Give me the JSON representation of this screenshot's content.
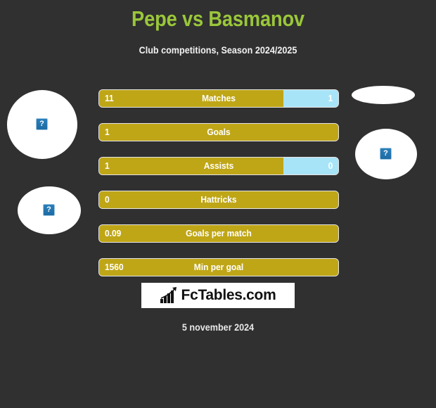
{
  "header": {
    "title": "Pepe vs Basmanov",
    "subtitle": "Club competitions, Season 2024/2025",
    "title_color": "#9ac73a"
  },
  "photos": {
    "home_top": {
      "alt_icon": "broken-image-icon",
      "glyph": "?"
    },
    "home_bottom": {
      "alt_icon": "broken-image-icon",
      "glyph": "?"
    },
    "away_top": {
      "alt_icon": "",
      "glyph": ""
    },
    "away_bottom": {
      "alt_icon": "broken-image-icon",
      "glyph": "?"
    }
  },
  "colors": {
    "home_bar": "#bfa617",
    "away_bar": "#a8e4f7",
    "background": "#303030",
    "bar_border": "#e6e6e6"
  },
  "chart_data": {
    "type": "bar",
    "title": "Pepe vs Basmanov",
    "subtitle": "Club competitions, Season 2024/2025",
    "orientation": "horizontal-diverging",
    "series": [
      {
        "name": "Pepe",
        "color": "#bfa617",
        "values": [
          11,
          1,
          1,
          0,
          0.09,
          1560
        ]
      },
      {
        "name": "Basmanov",
        "color": "#a8e4f7",
        "values": [
          1,
          0,
          0,
          0,
          0,
          0
        ]
      }
    ],
    "categories": [
      "Matches",
      "Goals",
      "Assists",
      "Hattricks",
      "Goals per match",
      "Min per goal"
    ],
    "rows": [
      {
        "label": "Matches",
        "home_value": "11",
        "away_value": "1",
        "home_pct": 77,
        "away_pct": 23,
        "show_away": true
      },
      {
        "label": "Goals",
        "home_value": "1",
        "away_value": "",
        "home_pct": 100,
        "away_pct": 0,
        "show_away": false
      },
      {
        "label": "Assists",
        "home_value": "1",
        "away_value": "0",
        "home_pct": 77,
        "away_pct": 23,
        "show_away": true
      },
      {
        "label": "Hattricks",
        "home_value": "0",
        "away_value": "",
        "home_pct": 100,
        "away_pct": 0,
        "show_away": false
      },
      {
        "label": "Goals per match",
        "home_value": "0.09",
        "away_value": "",
        "home_pct": 100,
        "away_pct": 0,
        "show_away": false
      },
      {
        "label": "Min per goal",
        "home_value": "1560",
        "away_value": "",
        "home_pct": 100,
        "away_pct": 0,
        "show_away": false
      }
    ]
  },
  "logo": {
    "text": "FcTables.com",
    "mark": "bar-chart-arrow-icon"
  },
  "footer": {
    "date": "5 november 2024"
  }
}
